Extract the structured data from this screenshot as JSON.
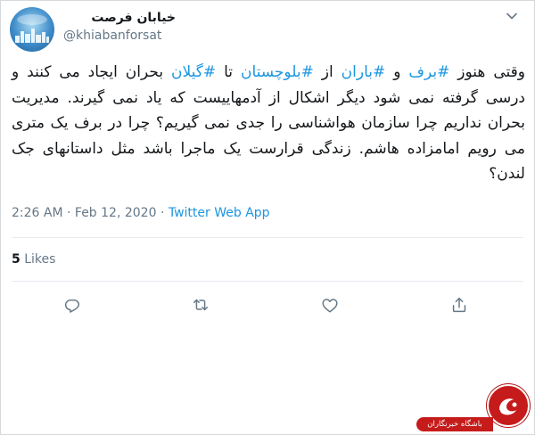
{
  "tweet": {
    "display_name": "خیابان فرصت",
    "handle": "@khiabanforsat",
    "text": {
      "p1": "وقتی هنوز ",
      "tag1": "#برف",
      "p2": " و ",
      "tag2": "#باران",
      "p3": " از ",
      "tag3": "#بلوچستان",
      "p4": " تا ",
      "tag4": "#گیلان",
      "p5": " بحران ایجاد می کنند و درسی گرفته نمی شود دیگر اشکال از آدمهاییست که یاد نمی گیرند. مدیریت بحران نداریم چرا سازمان هواشناسی را جدی نمی گیریم؟ چرا در برف یک متری می رویم امامزاده هاشم. زندگی قرارست یک ماجرا باشد مثل داستانهای جک لندن؟"
    },
    "time": "2:26 AM",
    "separator": "·",
    "date": "Feb 12, 2020",
    "app": "Twitter Web App",
    "likes_count": "5",
    "likes_label": "Likes"
  },
  "icons": {
    "menu": "chevron-down-icon",
    "reply": "reply-icon",
    "retweet": "retweet-icon",
    "like": "heart-icon",
    "share": "share-icon"
  },
  "watermark": {
    "text": "باشگاه خبرنگاران"
  },
  "colors": {
    "link": "#1b95e0",
    "secondary": "#657786",
    "brand_red": "#c61b1b"
  }
}
